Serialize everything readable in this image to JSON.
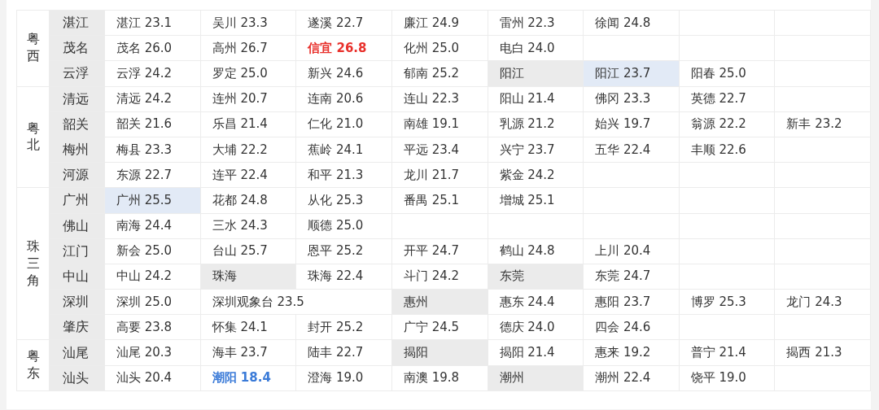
{
  "regions": [
    {
      "name": "粤西",
      "rows": [
        {
          "city": "湛江",
          "cells": [
            {
              "text": "湛江 23.1",
              "kind": "value"
            },
            {
              "text": "吴川 23.3",
              "kind": "value"
            },
            {
              "text": "遂溪 22.7",
              "kind": "value"
            },
            {
              "text": "廉江 24.9",
              "kind": "value"
            },
            {
              "text": "雷州 22.3",
              "kind": "value"
            },
            {
              "text": "徐闻 24.8",
              "kind": "value"
            }
          ]
        },
        {
          "city": "茂名",
          "cells": [
            {
              "text": "茂名 26.0",
              "kind": "value"
            },
            {
              "text": "高州 26.7",
              "kind": "value"
            },
            {
              "text": "信宜 26.8",
              "kind": "hot"
            },
            {
              "text": "化州 25.0",
              "kind": "value"
            },
            {
              "text": "电白 24.0",
              "kind": "value"
            }
          ]
        },
        {
          "city": "云浮",
          "cells": [
            {
              "text": "云浮 24.2",
              "kind": "value"
            },
            {
              "text": "罗定 25.0",
              "kind": "value"
            },
            {
              "text": "新兴 24.6",
              "kind": "value"
            },
            {
              "text": "郁南 25.2",
              "kind": "value"
            },
            {
              "text": "阳江",
              "kind": "city"
            },
            {
              "text": "阳江 23.7",
              "kind": "home"
            },
            {
              "text": "阳春 25.0",
              "kind": "value"
            }
          ]
        }
      ]
    },
    {
      "name": "粤北",
      "rows": [
        {
          "city": "清远",
          "cells": [
            {
              "text": "清远 24.2",
              "kind": "value"
            },
            {
              "text": "连州 20.7",
              "kind": "value"
            },
            {
              "text": "连南 20.6",
              "kind": "value"
            },
            {
              "text": "连山 22.3",
              "kind": "value"
            },
            {
              "text": "阳山 21.4",
              "kind": "value"
            },
            {
              "text": "佛冈 23.3",
              "kind": "value"
            },
            {
              "text": "英德 22.7",
              "kind": "value"
            }
          ]
        },
        {
          "city": "韶关",
          "cells": [
            {
              "text": "韶关 21.6",
              "kind": "value"
            },
            {
              "text": "乐昌 21.4",
              "kind": "value"
            },
            {
              "text": "仁化 21.0",
              "kind": "value"
            },
            {
              "text": "南雄 19.1",
              "kind": "value"
            },
            {
              "text": "乳源 21.2",
              "kind": "value"
            },
            {
              "text": "始兴 19.7",
              "kind": "value"
            },
            {
              "text": "翁源 22.2",
              "kind": "value"
            },
            {
              "text": "新丰 23.2",
              "kind": "value"
            }
          ]
        },
        {
          "city": "梅州",
          "cells": [
            {
              "text": "梅县 23.3",
              "kind": "value"
            },
            {
              "text": "大埔 22.2",
              "kind": "value"
            },
            {
              "text": "蕉岭 24.1",
              "kind": "value"
            },
            {
              "text": "平远 23.4",
              "kind": "value"
            },
            {
              "text": "兴宁 23.7",
              "kind": "value"
            },
            {
              "text": "五华 22.4",
              "kind": "value"
            },
            {
              "text": "丰顺 22.6",
              "kind": "value"
            }
          ]
        },
        {
          "city": "河源",
          "cells": [
            {
              "text": "东源 22.7",
              "kind": "value"
            },
            {
              "text": "连平 22.4",
              "kind": "value"
            },
            {
              "text": "和平 21.3",
              "kind": "value"
            },
            {
              "text": "龙川 21.7",
              "kind": "value"
            },
            {
              "text": "紫金 24.2",
              "kind": "value"
            }
          ]
        }
      ]
    },
    {
      "name": "珠三角",
      "rows": [
        {
          "city": "广州",
          "cells": [
            {
              "text": "广州 25.5",
              "kind": "home"
            },
            {
              "text": "花都 24.8",
              "kind": "value"
            },
            {
              "text": "从化 25.3",
              "kind": "value"
            },
            {
              "text": "番禺 25.1",
              "kind": "value"
            },
            {
              "text": "增城 25.1",
              "kind": "value"
            }
          ]
        },
        {
          "city": "佛山",
          "cells": [
            {
              "text": "南海 24.4",
              "kind": "value"
            },
            {
              "text": "三水 24.3",
              "kind": "value"
            },
            {
              "text": "顺德 25.0",
              "kind": "value"
            }
          ]
        },
        {
          "city": "江门",
          "cells": [
            {
              "text": "新会 25.0",
              "kind": "value"
            },
            {
              "text": "台山 25.7",
              "kind": "value"
            },
            {
              "text": "恩平 25.2",
              "kind": "value"
            },
            {
              "text": "开平 24.7",
              "kind": "value"
            },
            {
              "text": "鹤山 24.8",
              "kind": "value"
            },
            {
              "text": "上川 20.4",
              "kind": "value"
            }
          ]
        },
        {
          "city": "中山",
          "cells": [
            {
              "text": "中山 24.2",
              "kind": "value"
            },
            {
              "text": "珠海",
              "kind": "city"
            },
            {
              "text": "珠海 22.4",
              "kind": "value"
            },
            {
              "text": "斗门 24.2",
              "kind": "value"
            },
            {
              "text": "东莞",
              "kind": "city"
            },
            {
              "text": "东莞 24.7",
              "kind": "value"
            }
          ]
        },
        {
          "city": "深圳",
          "cells": [
            {
              "text": "深圳 25.0",
              "kind": "value"
            },
            {
              "text": "深圳观象台 23.5",
              "kind": "value",
              "colspan": 2
            },
            {
              "text": "惠州",
              "kind": "city"
            },
            {
              "text": "惠东 24.4",
              "kind": "value"
            },
            {
              "text": "惠阳 23.7",
              "kind": "value"
            },
            {
              "text": "博罗 25.3",
              "kind": "value"
            },
            {
              "text": "龙门 24.3",
              "kind": "value"
            }
          ]
        },
        {
          "city": "肇庆",
          "cells": [
            {
              "text": "高要 23.8",
              "kind": "value"
            },
            {
              "text": "怀集 24.1",
              "kind": "value"
            },
            {
              "text": "封开 25.2",
              "kind": "value"
            },
            {
              "text": "广宁 24.5",
              "kind": "value"
            },
            {
              "text": "德庆 24.0",
              "kind": "value"
            },
            {
              "text": "四会 24.6",
              "kind": "value"
            }
          ]
        }
      ]
    },
    {
      "name": "粤东",
      "rows": [
        {
          "city": "汕尾",
          "cells": [
            {
              "text": "汕尾 20.3",
              "kind": "value"
            },
            {
              "text": "海丰 23.7",
              "kind": "value"
            },
            {
              "text": "陆丰 22.7",
              "kind": "value"
            },
            {
              "text": "揭阳",
              "kind": "city"
            },
            {
              "text": "揭阳 21.4",
              "kind": "value"
            },
            {
              "text": "惠来 19.2",
              "kind": "value"
            },
            {
              "text": "普宁 21.4",
              "kind": "value"
            },
            {
              "text": "揭西 21.3",
              "kind": "value"
            }
          ]
        },
        {
          "city": "汕头",
          "cells": [
            {
              "text": "汕头 20.4",
              "kind": "value"
            },
            {
              "text": "潮阳 18.4",
              "kind": "cold"
            },
            {
              "text": "澄海 19.0",
              "kind": "value"
            },
            {
              "text": "南澳 19.8",
              "kind": "value"
            },
            {
              "text": "潮州",
              "kind": "city"
            },
            {
              "text": "潮州 22.4",
              "kind": "value"
            },
            {
              "text": "饶平 19.0",
              "kind": "value"
            }
          ]
        }
      ]
    }
  ]
}
